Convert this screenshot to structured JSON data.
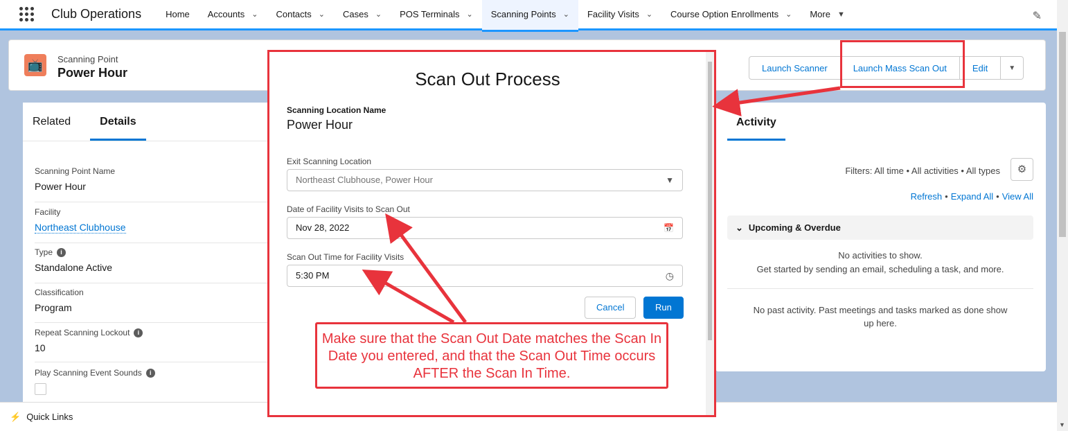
{
  "app": {
    "name": "Club Operations"
  },
  "nav": {
    "items": [
      {
        "label": "Home",
        "chevron": false
      },
      {
        "label": "Accounts",
        "chevron": true
      },
      {
        "label": "Contacts",
        "chevron": true
      },
      {
        "label": "Cases",
        "chevron": true
      },
      {
        "label": "POS Terminals",
        "chevron": true
      },
      {
        "label": "Scanning Points",
        "chevron": true,
        "active": true
      },
      {
        "label": "Facility Visits",
        "chevron": true
      },
      {
        "label": "Course Option Enrollments",
        "chevron": true
      },
      {
        "label": "More",
        "chevron": true
      }
    ]
  },
  "record": {
    "object_type": "Scanning Point",
    "name": "Power Hour",
    "buttons": {
      "launch_scanner": "Launch Scanner",
      "launch_mass_scan_out": "Launch Mass Scan Out",
      "edit": "Edit"
    }
  },
  "left_panel": {
    "tabs": {
      "related": "Related",
      "details": "Details"
    },
    "fields": {
      "scanning_point_name": {
        "label": "Scanning Point Name",
        "value": "Power Hour"
      },
      "facility": {
        "label": "Facility",
        "value": "Northeast Clubhouse"
      },
      "type": {
        "label": "Type",
        "value": "Standalone Active"
      },
      "classification": {
        "label": "Classification",
        "value": "Program"
      },
      "repeat_lockout": {
        "label": "Repeat Scanning Lockout",
        "value": "10"
      },
      "play_sounds": {
        "label": "Play Scanning Event Sounds",
        "checked": false
      }
    }
  },
  "activity": {
    "tab": "Activity",
    "filters": "Filters: All time • All activities • All types",
    "links": {
      "refresh": "Refresh",
      "expand_all": "Expand All",
      "view_all": "View All"
    },
    "upcoming": "Upcoming & Overdue",
    "no_activities": "No activities to show.",
    "get_started": "Get started by sending an email, scheduling a task, and more.",
    "no_past": "No past activity. Past meetings and tasks marked as done show up here."
  },
  "modal": {
    "title": "Scan Out Process",
    "location_label": "Scanning Location Name",
    "location_value": "Power Hour",
    "exit_label": "Exit Scanning Location",
    "exit_value": "Northeast Clubhouse, Power Hour",
    "date_label": "Date of Facility Visits to Scan Out",
    "date_value": "Nov 28, 2022",
    "time_label": "Scan Out Time for Facility Visits",
    "time_value": "5:30 PM",
    "cancel": "Cancel",
    "run": "Run"
  },
  "callout": {
    "text": "Make sure that the Scan Out Date matches the Scan In Date you entered, and that the Scan Out Time occurs AFTER the Scan In Time."
  },
  "footer": {
    "quick_links": "Quick Links"
  },
  "colors": {
    "brand": "#0176d3",
    "annotation": "#e8333c",
    "object_icon": "#ef7e5b"
  },
  "icons": [
    "waffle-icon",
    "chevron-down-icon",
    "pencil-icon",
    "tv-icon",
    "info-icon",
    "gear-icon",
    "calendar-icon",
    "clock-icon",
    "bolt-icon",
    "caret-down-icon"
  ]
}
